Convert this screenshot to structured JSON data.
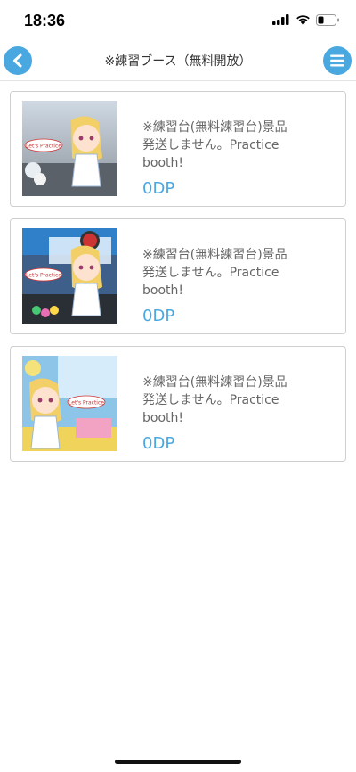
{
  "status": {
    "time": "18:36"
  },
  "header": {
    "title": "※練習ブース（無料開放）"
  },
  "items": [
    {
      "description": "※練習台(無料練習台)景品発送しません。Practice booth!",
      "price": "0DP",
      "thumb_caption": "Let's Practice"
    },
    {
      "description": "※練習台(無料練習台)景品発送しません。Practice booth!",
      "price": "0DP",
      "thumb_caption": "Let's Practice"
    },
    {
      "description": "※練習台(無料練習台)景品発送しません。Practice booth!",
      "price": "0DP",
      "thumb_caption": "Let's Practice"
    }
  ],
  "colors": {
    "accent": "#4aa8e0",
    "text": "#666666"
  }
}
